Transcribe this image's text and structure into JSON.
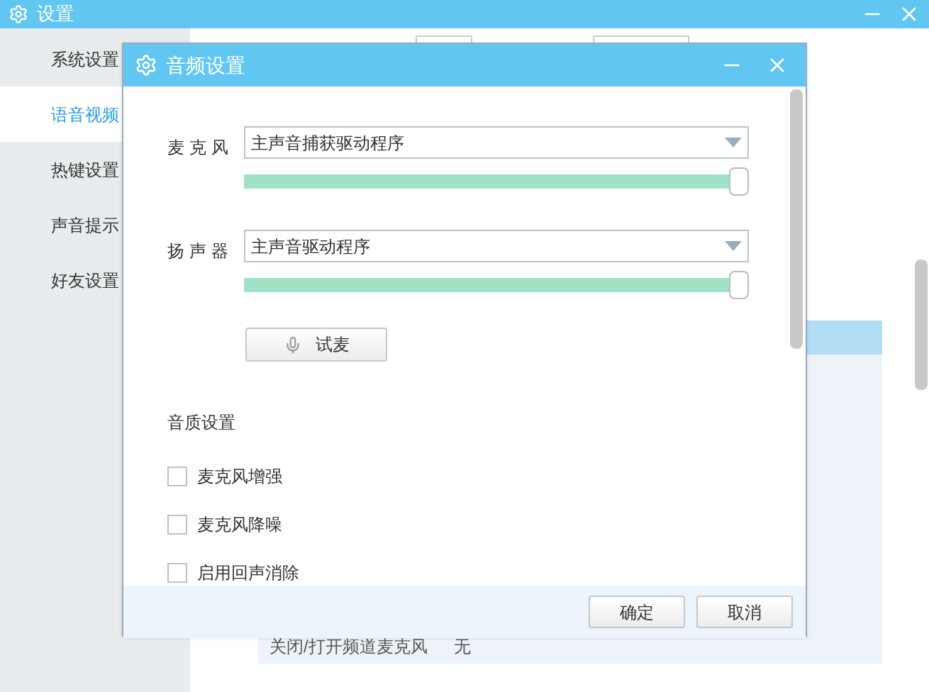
{
  "window": {
    "title": "设置"
  },
  "sidebar": {
    "items": [
      {
        "label": "系统设置",
        "selected": false
      },
      {
        "label": "语音视频",
        "selected": true
      },
      {
        "label": "热键设置",
        "selected": false
      },
      {
        "label": "声音提示",
        "selected": false
      },
      {
        "label": "好友设置",
        "selected": false
      }
    ]
  },
  "background_table": {
    "rows": [
      {
        "action": "关闭/打开频道麦克风",
        "shortcut": "无"
      }
    ]
  },
  "dialog": {
    "title": "音频设置",
    "devices": [
      {
        "label": "麦克风",
        "value": "主声音捕获驱动程序",
        "level": 0.98
      },
      {
        "label": "扬声器",
        "value": "主声音驱动程序",
        "level": 0.98
      }
    ],
    "test_button": "试麦",
    "section_title": "音质设置",
    "options": [
      {
        "label": "麦克风增强",
        "checked": false
      },
      {
        "label": "麦克风降噪",
        "checked": false
      },
      {
        "label": "启用回声消除",
        "checked": false
      }
    ],
    "buttons": [
      "确定",
      "取消"
    ]
  }
}
